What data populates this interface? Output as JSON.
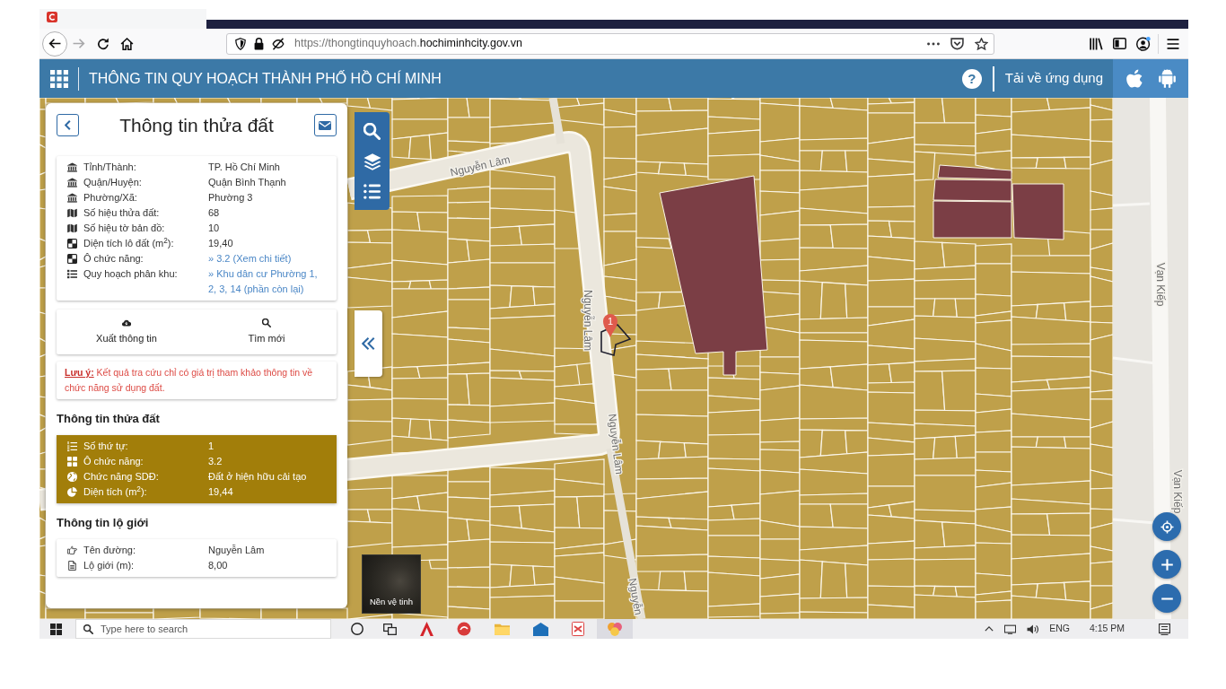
{
  "browser": {
    "forward_disabled": true,
    "url_prefix": "https://thongtinquyhoach.",
    "url_domain": "hochiminhcity.gov.vn"
  },
  "header": {
    "title": "THÔNG TIN QUY HOẠCH THÀNH PHỐ HỒ CHÍ MINH",
    "help": "?",
    "download_label": "Tải về ứng dụng"
  },
  "panel": {
    "title": "Thông tin thửa đất",
    "info_rows": [
      {
        "kind": "admin",
        "label": "Tỉnh/Thành:",
        "value": "TP. Hồ Chí Minh",
        "link": false
      },
      {
        "kind": "admin",
        "label": "Quận/Huyện:",
        "value": "Quận Bình Thạnh",
        "link": false
      },
      {
        "kind": "admin",
        "label": "Phường/Xã:",
        "value": "Phường 3",
        "link": false
      },
      {
        "kind": "map",
        "label": "Số hiệu thửa đất:",
        "value": "68",
        "link": false
      },
      {
        "kind": "map",
        "label": "Số hiệu tờ bản đồ:",
        "value": "10",
        "link": false
      },
      {
        "kind": "area",
        "label": "Diện tích lô đất (m$^{2}$):",
        "value": "19,40",
        "link": false
      },
      {
        "kind": "area",
        "label": "Ô chức năng:",
        "value": "» 3.2 (Xem chi tiết)",
        "link": true
      },
      {
        "kind": "list",
        "label": "Quy hoạch phân khu:",
        "value": "» Khu dân cư Phường 1, 2, 3, 14 (phần còn lại)",
        "link": true
      }
    ],
    "actions": [
      {
        "kind": "export",
        "label": "Xuất thông tin"
      },
      {
        "kind": "search",
        "label": "Tìm mới"
      }
    ],
    "note": "**Lưu ý:** Kết quả tra cứu chỉ có giá trị tham khảo thông tin về chức năng sử dụng đất.",
    "sections": [
      {
        "heading": "Thông tin thửa đất",
        "kind": "highlight",
        "rows": [
          {
            "kind": "order",
            "label": "Số thứ tự:",
            "value": "1"
          },
          {
            "kind": "cell",
            "label": "Ô chức năng:",
            "value": "3.2"
          },
          {
            "kind": "use",
            "label": "Chức năng SDĐ:",
            "value": "Đất ở hiện hữu cải tạo"
          },
          {
            "kind": "size",
            "label": "Diện tích (m$^{2}$):",
            "value": "19,44"
          }
        ]
      },
      {
        "heading": "Thông tin lộ giới",
        "kind": "plain",
        "rows": [
          {
            "kind": "road",
            "label": "Tên đường:",
            "value": "Nguyễn Lâm"
          },
          {
            "kind": "width",
            "label": "Lộ giới (m):",
            "value": "8,00"
          }
        ]
      }
    ]
  },
  "map": {
    "street_labels": [
      "Nguyễn Lâm",
      "Nguyễn Lâm",
      "Nguyễn Lâm",
      "Nguyễn",
      "Vạn Kiếp",
      "Vạn Kiếp"
    ],
    "marker": "1",
    "basemap_toggle": "Nền vệ tinh"
  },
  "taskbar": {
    "search_placeholder": "Type here to search",
    "language": "ENG",
    "time": "4:15 PM"
  }
}
